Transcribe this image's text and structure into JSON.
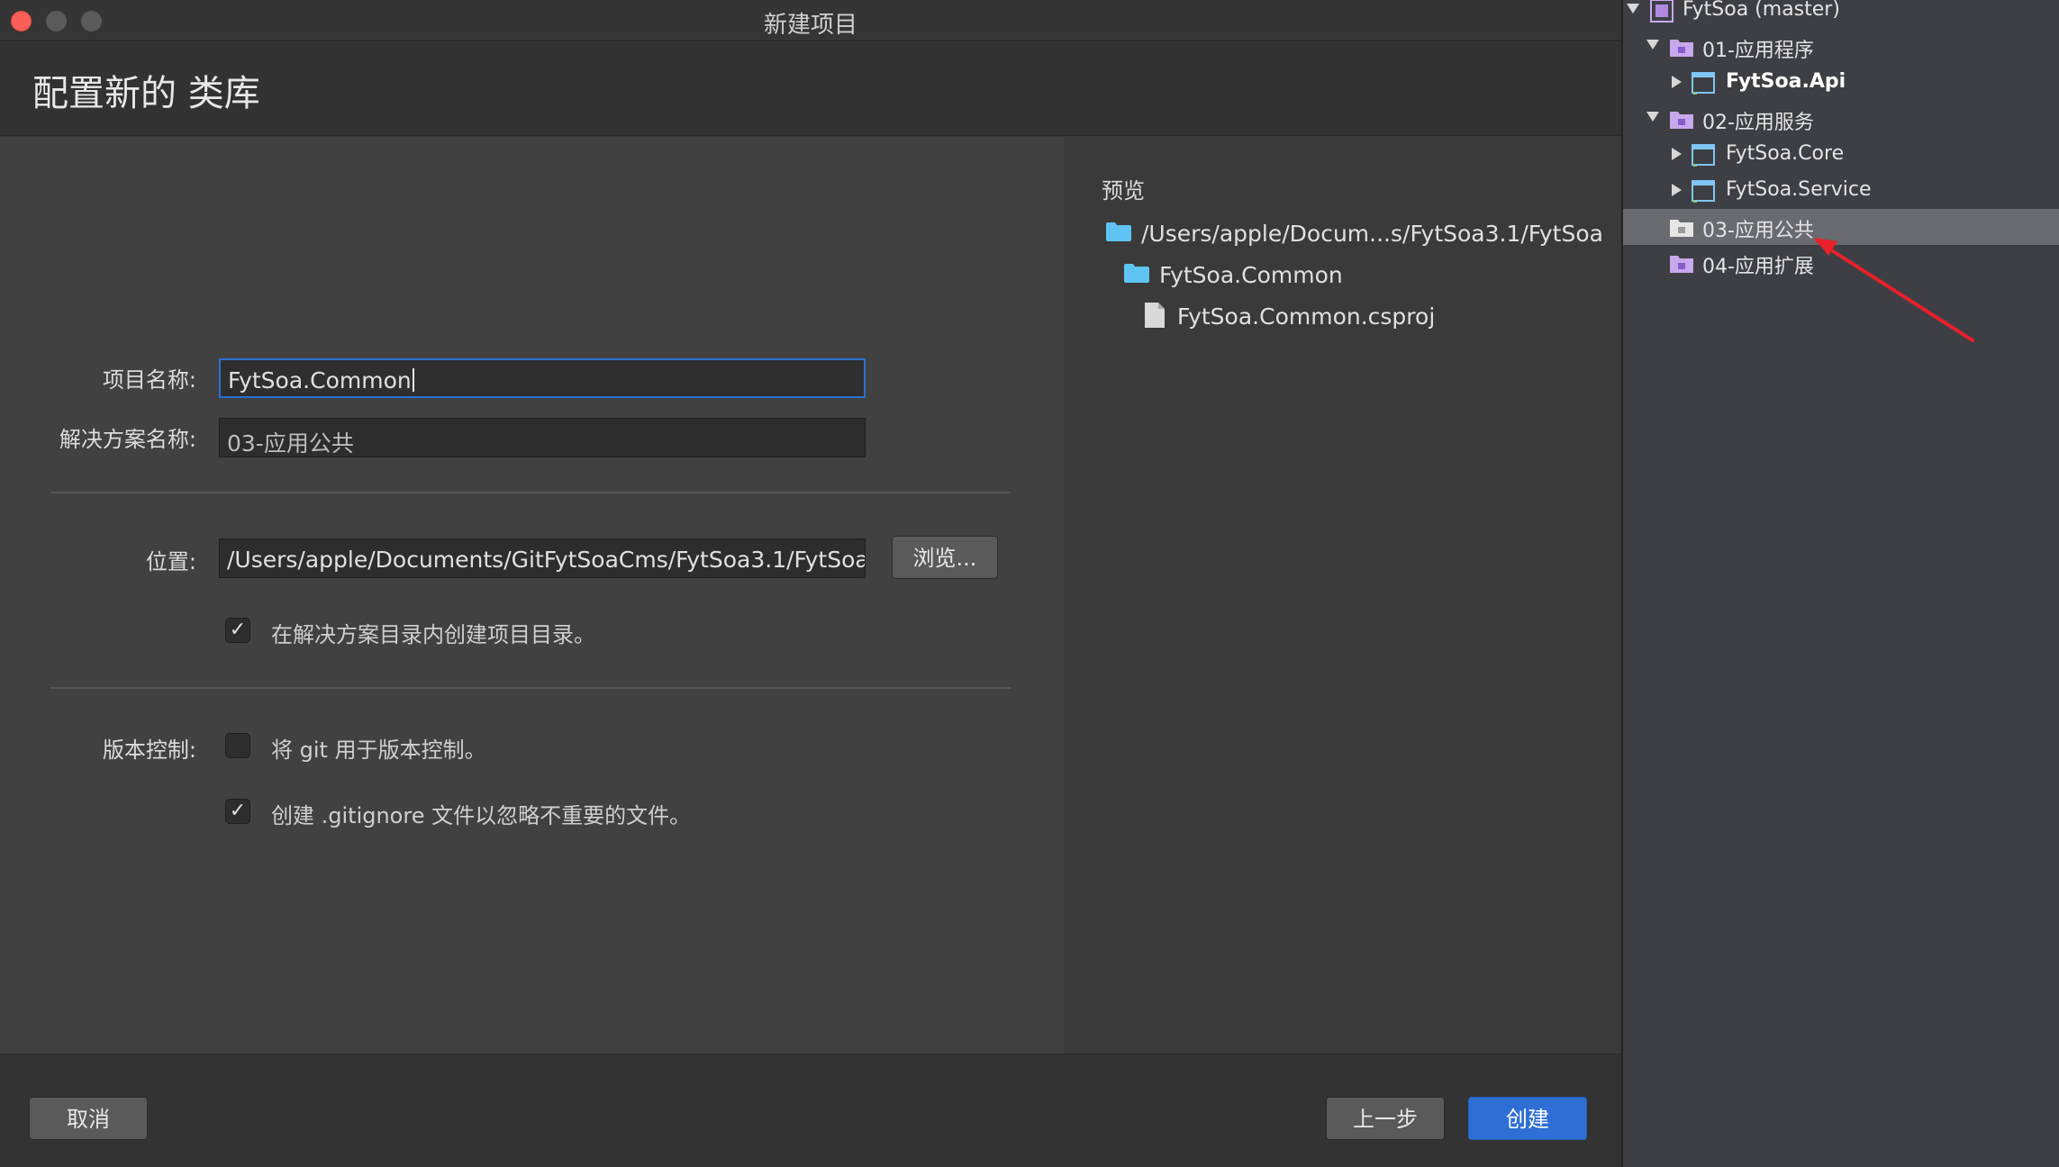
{
  "window": {
    "title": "新建项目"
  },
  "header": {
    "heading": "配置新的 类库"
  },
  "form": {
    "project_name": {
      "label": "项目名称:",
      "value": "FytSoa.Common"
    },
    "solution_name": {
      "label": "解决方案名称:",
      "value": "03-应用公共"
    },
    "location": {
      "label": "位置:",
      "value": "/Users/apple/Documents/GitFytSoaCms/FytSoa3.1/FytSoa",
      "browse_label": "浏览..."
    },
    "create_dir": {
      "checked": true,
      "label": "在解决方案目录内创建项目目录。"
    },
    "vcs": {
      "label": "版本控制:",
      "use_git": {
        "checked": false,
        "label": "将 git 用于版本控制。"
      },
      "gitignore": {
        "checked": true,
        "label": "创建 .gitignore 文件以忽略不重要的文件。"
      }
    }
  },
  "preview": {
    "title": "预览",
    "root_path": "/Users/apple/Docum...s/FytSoa3.1/FytSoa",
    "project_folder": "FytSoa.Common",
    "project_file": "FytSoa.Common.csproj"
  },
  "footer": {
    "cancel_label": "取消",
    "back_label": "上一步",
    "create_label": "创建"
  },
  "solution_tree": {
    "items": [
      {
        "label": "FytSoa (master)",
        "kind": "solution",
        "expanded": true
      },
      {
        "label": "01-应用程序",
        "kind": "solution-folder",
        "expanded": true
      },
      {
        "label": "FytSoa.Api",
        "kind": "project",
        "expanded": false,
        "bold": true
      },
      {
        "label": "02-应用服务",
        "kind": "solution-folder",
        "expanded": true
      },
      {
        "label": "FytSoa.Core",
        "kind": "project",
        "expanded": false
      },
      {
        "label": "FytSoa.Service",
        "kind": "project",
        "expanded": false
      },
      {
        "label": "03-应用公共",
        "kind": "solution-folder",
        "selected": true
      },
      {
        "label": "04-应用扩展",
        "kind": "solution-folder"
      }
    ]
  },
  "colors": {
    "accent": "#2f6fd5",
    "annotation_arrow": "#e8202a",
    "selection": "#6a6b70"
  }
}
